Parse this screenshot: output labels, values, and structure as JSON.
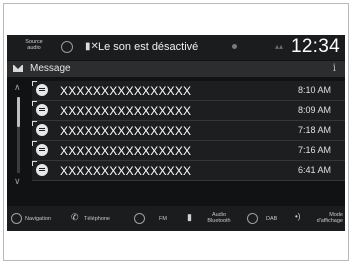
{
  "status_bar": {
    "source_label": "Source audio",
    "mute_icon": "speaker-muted-icon",
    "message": "Le son est désactivé",
    "clock": "12:34"
  },
  "header": {
    "icon": "envelope-icon",
    "title": "Message",
    "info_icon": "i"
  },
  "messages": [
    {
      "sender": "XXXXXXXXXXXXXXXX",
      "time": "8:10 AM"
    },
    {
      "sender": "XXXXXXXXXXXXXXXX",
      "time": "8:09 AM"
    },
    {
      "sender": "XXXXXXXXXXXXXXXX",
      "time": "7:18 AM"
    },
    {
      "sender": "XXXXXXXXXXXXXXXX",
      "time": "7:16 AM"
    },
    {
      "sender": "XXXXXXXXXXXXXXXX",
      "time": "6:41 AM"
    }
  ],
  "shortcuts": {
    "navigation": "Navigation",
    "telephone": "Téléphone",
    "fm": "FM",
    "bluetooth_audio": "Audio Bluetooth",
    "dab": "DAB",
    "display_mode": "Mode d'affichage"
  }
}
